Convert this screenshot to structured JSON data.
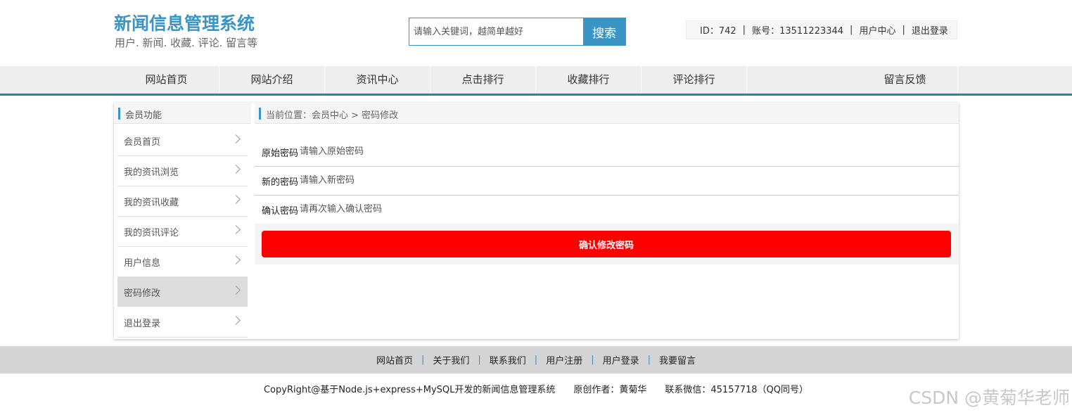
{
  "brand": {
    "title": "新闻信息管理系统",
    "subtitle": "用户. 新闻. 收藏. 评论. 留言等"
  },
  "search": {
    "placeholder": "请输入关键词，越简单越好",
    "button": "搜索"
  },
  "user": {
    "id_text": "ID：742",
    "account_text": "账号：13511223344",
    "center": "用户中心",
    "logout": "退出登录",
    "sep": "|"
  },
  "nav": {
    "items": [
      "网站首页",
      "网站介绍",
      "资讯中心",
      "点击排行",
      "收藏排行",
      "评论排行",
      "留言反馈"
    ]
  },
  "sidebar": {
    "title": "会员功能",
    "items": [
      {
        "label": "会员首页"
      },
      {
        "label": "我的资讯浏览"
      },
      {
        "label": "我的资讯收藏"
      },
      {
        "label": "我的资讯评论"
      },
      {
        "label": "用户信息"
      },
      {
        "label": "密码修改",
        "active": true
      },
      {
        "label": "退出登录"
      }
    ]
  },
  "main": {
    "breadcrumb": "当前位置：会员中心 > 密码修改",
    "fields": [
      {
        "label": "原始密码",
        "placeholder": "请输入原始密码"
      },
      {
        "label": "新的密码",
        "placeholder": "请输入新密码"
      },
      {
        "label": "确认密码",
        "placeholder": "请再次输入确认密码"
      }
    ],
    "submit": "确认修改密码"
  },
  "footer": {
    "links": [
      "网站首页",
      "关于我们",
      "联系我们",
      "用户注册",
      "用户登录",
      "我要留言"
    ],
    "sep": "|",
    "copyright": "CopyRight@基于Node.js+express+MySQL开发的新闻信息管理系统　　原创作者：黄菊华　　联系微信：45157718（QQ同号）"
  },
  "watermark": "CSDN @黄菊华老师",
  "colors": {
    "brand": "#3a95c6",
    "nav_border": "#1c8c8c",
    "submit": "#ff0000"
  }
}
